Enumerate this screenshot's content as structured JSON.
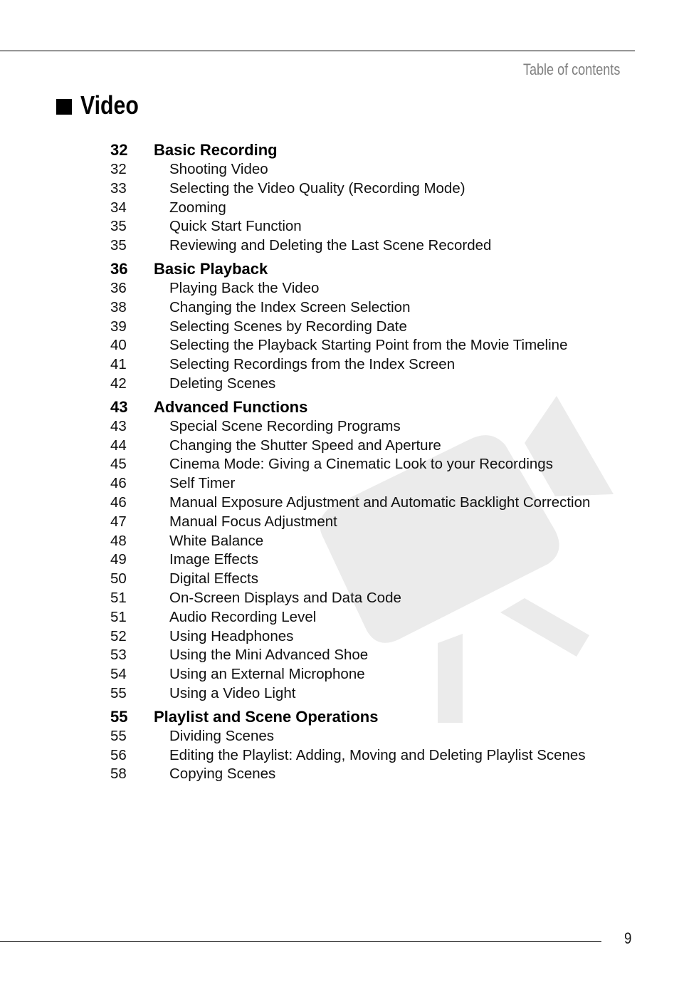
{
  "header": {
    "running_head": "Table of contents"
  },
  "section": {
    "title": "Video",
    "bullet_icon": "black-square"
  },
  "watermark": {
    "icon": "video-camera-icon",
    "color": "#ebebeb"
  },
  "toc": [
    {
      "page": "32",
      "title": "Basic Recording",
      "entries": [
        {
          "page": "32",
          "title": "Shooting Video"
        },
        {
          "page": "33",
          "title": "Selecting the Video Quality (Recording Mode)"
        },
        {
          "page": "34",
          "title": "Zooming"
        },
        {
          "page": "35",
          "title": "Quick Start Function"
        },
        {
          "page": "35",
          "title": "Reviewing and Deleting the Last Scene Recorded"
        }
      ]
    },
    {
      "page": "36",
      "title": "Basic Playback",
      "entries": [
        {
          "page": "36",
          "title": "Playing Back the Video"
        },
        {
          "page": "38",
          "title": "Changing the Index Screen Selection"
        },
        {
          "page": "39",
          "title": "Selecting Scenes by Recording Date"
        },
        {
          "page": "40",
          "title": "Selecting the Playback Starting Point from the Movie Timeline"
        },
        {
          "page": "41",
          "title": "Selecting Recordings from the Index Screen"
        },
        {
          "page": "42",
          "title": "Deleting Scenes"
        }
      ]
    },
    {
      "page": "43",
      "title": "Advanced Functions",
      "entries": [
        {
          "page": "43",
          "title": "Special Scene Recording Programs"
        },
        {
          "page": "44",
          "title": "Changing the Shutter Speed and Aperture"
        },
        {
          "page": "45",
          "title": "Cinema Mode: Giving a Cinematic Look to your Recordings"
        },
        {
          "page": "46",
          "title": "Self Timer"
        },
        {
          "page": "46",
          "title": "Manual Exposure Adjustment and Automatic Backlight Correction"
        },
        {
          "page": "47",
          "title": "Manual Focus Adjustment"
        },
        {
          "page": "48",
          "title": "White Balance"
        },
        {
          "page": "49",
          "title": "Image Effects"
        },
        {
          "page": "50",
          "title": "Digital Effects"
        },
        {
          "page": "51",
          "title": "On-Screen Displays and Data Code"
        },
        {
          "page": "51",
          "title": "Audio Recording Level"
        },
        {
          "page": "52",
          "title": "Using Headphones"
        },
        {
          "page": "53",
          "title": "Using the Mini Advanced Shoe"
        },
        {
          "page": "54",
          "title": "Using an External Microphone"
        },
        {
          "page": "55",
          "title": "Using a Video Light"
        }
      ]
    },
    {
      "page": "55",
      "title": "Playlist and Scene Operations",
      "entries": [
        {
          "page": "55",
          "title": "Dividing Scenes"
        },
        {
          "page": "56",
          "title": "Editing the Playlist: Adding, Moving and Deleting Playlist Scenes"
        },
        {
          "page": "58",
          "title": "Copying Scenes"
        }
      ]
    }
  ],
  "footer": {
    "page_number": "9"
  }
}
